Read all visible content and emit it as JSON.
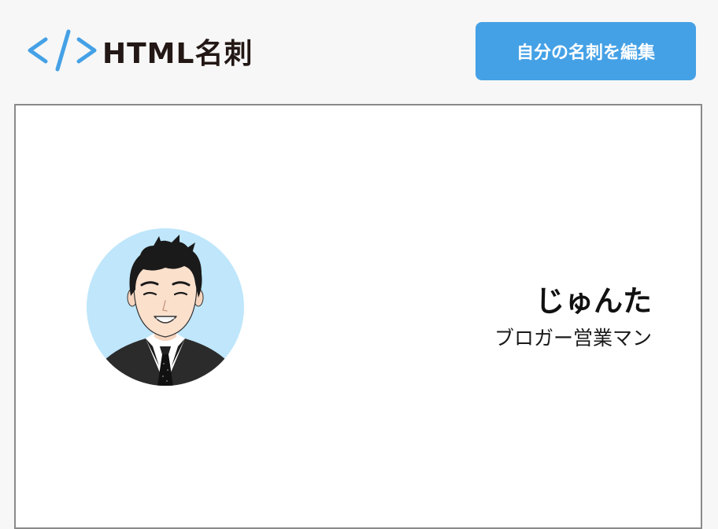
{
  "header": {
    "logo_text": "HTML名刺",
    "logo_icon": "code-brackets-icon",
    "edit_button_label": "自分の名刺を編集"
  },
  "card": {
    "name": "じゅんた",
    "title": "ブロガー営業マン",
    "avatar": "avatar-illustration"
  },
  "colors": {
    "accent": "#45a1e6",
    "logo_text": "#231815",
    "avatar_background": "#bfe6fb",
    "card_border": "#8a8a8a",
    "page_background": "#f7f7f7"
  }
}
